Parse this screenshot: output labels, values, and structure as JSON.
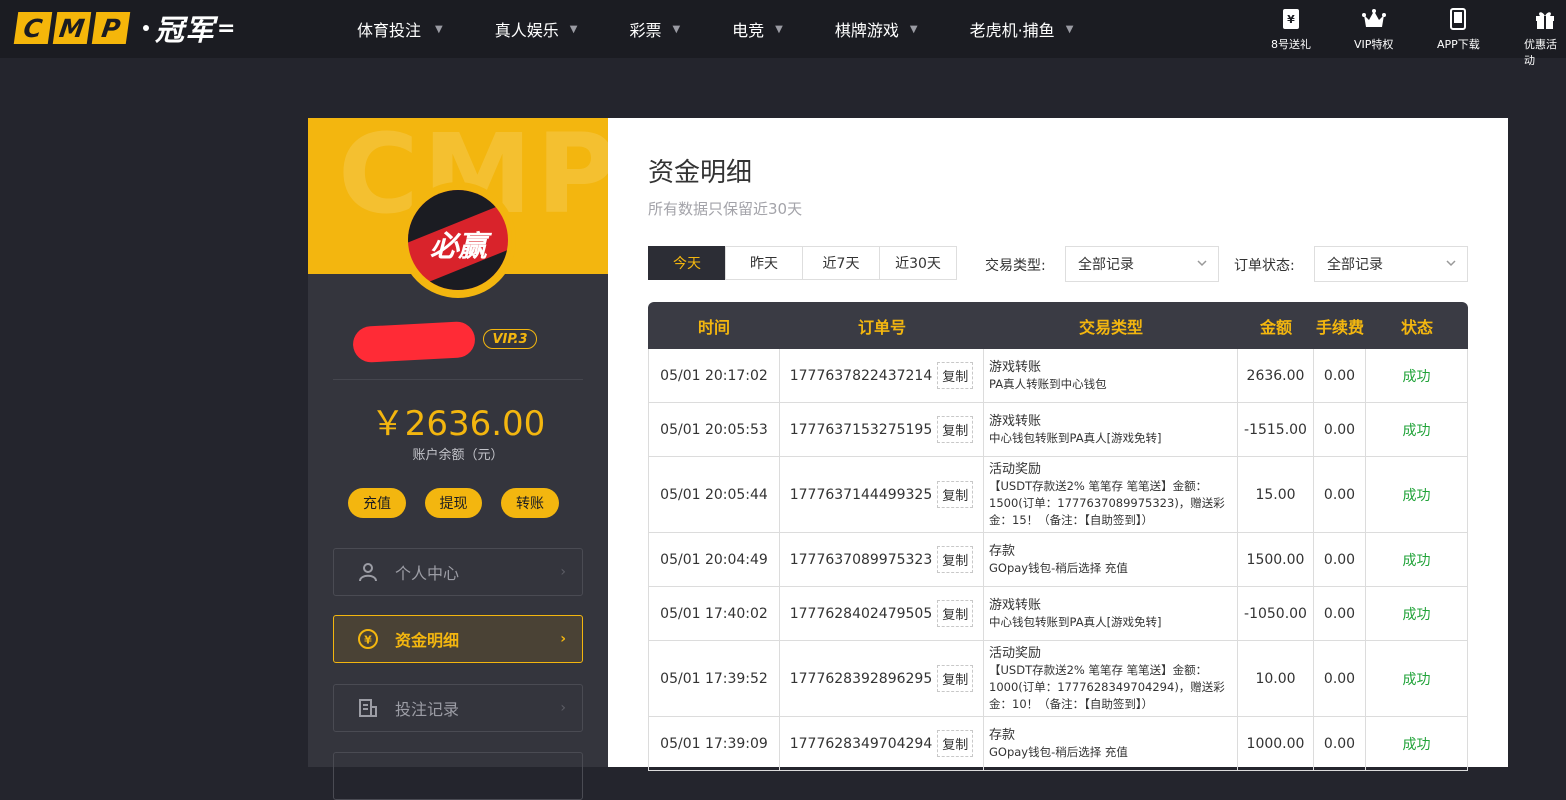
{
  "brand": {
    "logo_letters": [
      "C",
      "M",
      "P"
    ],
    "logo_cn": "冠军",
    "logo_dash": "="
  },
  "nav": [
    {
      "label": "体育投注"
    },
    {
      "label": "真人娱乐"
    },
    {
      "label": "彩票"
    },
    {
      "label": "电竞"
    },
    {
      "label": "棋牌游戏"
    },
    {
      "label": "老虎机·捕鱼"
    }
  ],
  "tools": [
    {
      "label": "8号送礼",
      "icon": "yen-gift-icon"
    },
    {
      "label": "VIP特权",
      "icon": "crown-icon"
    },
    {
      "label": "APP下载",
      "icon": "phone-icon"
    },
    {
      "label": "优惠活动",
      "icon": "gift-icon"
    }
  ],
  "sidebar": {
    "banner_watermark": "CMP",
    "avatar_text": "必赢",
    "vip_badge": "VIP.3",
    "balance": "￥2636.00",
    "balance_label": "账户余额（元）",
    "actions": [
      {
        "label": "充值"
      },
      {
        "label": "提现"
      },
      {
        "label": "转账"
      }
    ],
    "menu": [
      {
        "label": "个人中心",
        "icon": "user-icon"
      },
      {
        "label": "资金明细",
        "icon": "yen-circle-icon"
      },
      {
        "label": "投注记录",
        "icon": "bet-record-icon"
      }
    ]
  },
  "main": {
    "title": "资金明细",
    "subtitle": "所有数据只保留近30天",
    "tabs": [
      {
        "label": "今天"
      },
      {
        "label": "昨天"
      },
      {
        "label": "近7天"
      },
      {
        "label": "近30天"
      }
    ],
    "filters": {
      "type_label": "交易类型:",
      "type_value": "全部记录",
      "status_label": "订单状态:",
      "status_value": "全部记录"
    },
    "table": {
      "headers": [
        "时间",
        "订单号",
        "交易类型",
        "金额",
        "手续费",
        "状态"
      ],
      "copy_label": "复制",
      "rows": [
        {
          "time": "05/01 20:17:02",
          "order": "1777637822437214",
          "type": "游戏转账",
          "desc": [
            "PA真人转账到中心钱包"
          ],
          "amount": "2636.00",
          "fee": "0.00",
          "status": "成功"
        },
        {
          "time": "05/01 20:05:53",
          "order": "1777637153275195",
          "type": "游戏转账",
          "desc": [
            "中心钱包转账到PA真人[游戏免转]"
          ],
          "amount": "-1515.00",
          "fee": "0.00",
          "status": "成功"
        },
        {
          "time": "05/01 20:05:44",
          "order": "1777637144499325",
          "type": "活动奖励",
          "desc": [
            "【USDT存款送2% 笔笔存 笔笔送】金额：",
            "1500(订单：1777637089975323)，赠送彩",
            "金：15！（备注：【自助签到】）"
          ],
          "amount": "15.00",
          "fee": "0.00",
          "status": "成功"
        },
        {
          "time": "05/01 20:04:49",
          "order": "1777637089975323",
          "type": "存款",
          "desc": [
            "GOpay钱包-稍后选择 充值"
          ],
          "amount": "1500.00",
          "fee": "0.00",
          "status": "成功"
        },
        {
          "time": "05/01 17:40:02",
          "order": "1777628402479505",
          "type": "游戏转账",
          "desc": [
            "中心钱包转账到PA真人[游戏免转]"
          ],
          "amount": "-1050.00",
          "fee": "0.00",
          "status": "成功"
        },
        {
          "time": "05/01 17:39:52",
          "order": "1777628392896295",
          "type": "活动奖励",
          "desc": [
            "【USDT存款送2% 笔笔存 笔笔送】金额：",
            "1000(订单：1777628349704294)，赠送彩",
            "金：10！（备注：【自助签到】）"
          ],
          "amount": "10.00",
          "fee": "0.00",
          "status": "成功"
        },
        {
          "time": "05/01 17:39:09",
          "order": "1777628349704294",
          "type": "存款",
          "desc": [
            "GOpay钱包-稍后选择 充值"
          ],
          "amount": "1000.00",
          "fee": "0.00",
          "status": "成功"
        }
      ]
    }
  }
}
